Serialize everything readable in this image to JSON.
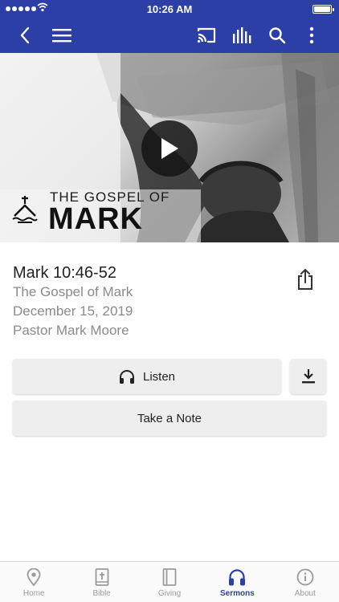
{
  "status_bar": {
    "time": "10:26 AM"
  },
  "hero": {
    "title_line1": "THE GOSPEL OF",
    "title_line2": "MARK"
  },
  "sermon": {
    "passage": "Mark 10:46-52",
    "series": "The Gospel of Mark",
    "date": "December 15, 2019",
    "speaker": "Pastor Mark Moore"
  },
  "actions": {
    "listen_label": "Listen",
    "note_label": "Take a Note"
  },
  "tabs": [
    {
      "label": "Home",
      "icon": "location-pin-icon",
      "active": false
    },
    {
      "label": "Bible",
      "icon": "bible-icon",
      "active": false
    },
    {
      "label": "Giving",
      "icon": "book-icon",
      "active": false
    },
    {
      "label": "Sermons",
      "icon": "headphones-icon",
      "active": true
    },
    {
      "label": "About",
      "icon": "info-icon",
      "active": false
    }
  ],
  "colors": {
    "brand": "#2b3fa6",
    "tab_inactive": "#9a9a9a"
  }
}
